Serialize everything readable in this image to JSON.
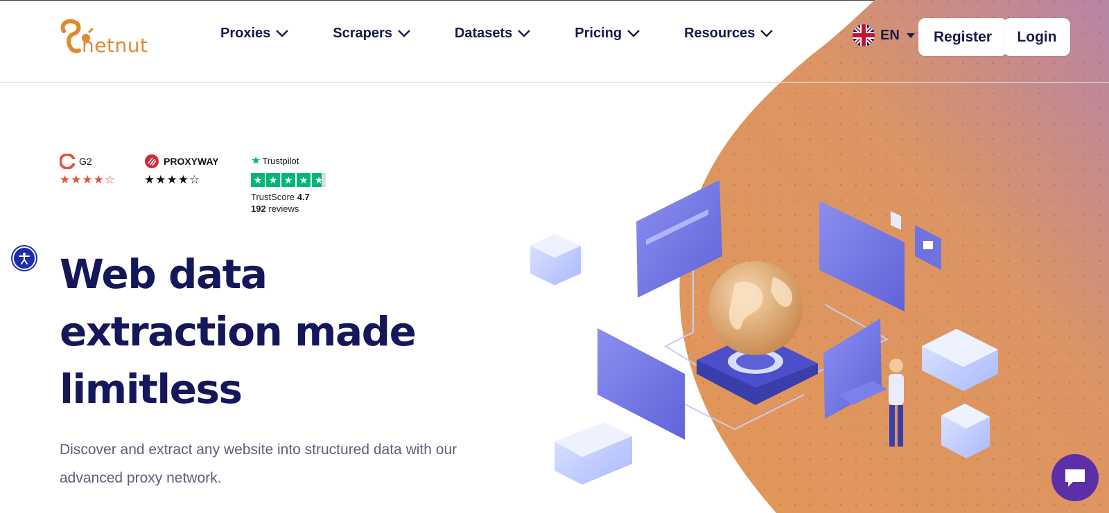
{
  "header": {
    "brand": "netnut",
    "nav": [
      {
        "label": "Proxies"
      },
      {
        "label": "Scrapers"
      },
      {
        "label": "Datasets"
      },
      {
        "label": "Pricing"
      },
      {
        "label": "Resources"
      }
    ],
    "language": "EN",
    "register_label": "Register",
    "login_label": "Login"
  },
  "ratings": {
    "g2": {
      "name": "G2",
      "stars": "★★★★☆",
      "value": 4.5
    },
    "proxyway": {
      "name": "PROXYWAY",
      "stars": "★★★★☆",
      "value": 4.5
    },
    "trustpilot": {
      "name": "Trustpilot",
      "value": 4.7,
      "score_label": "TrustScore",
      "score": "4.7",
      "reviews_count": "192",
      "reviews_label": "reviews"
    }
  },
  "hero": {
    "headline": [
      "Web data",
      "extraction made",
      "limitless"
    ],
    "subtext": "Discover and extract any website into structured data with our advanced proxy network."
  },
  "colors": {
    "brand_orange": "#e08a2e",
    "navy": "#14185a",
    "accent_purple": "#5b2fa8",
    "trustpilot_green": "#00b67a"
  }
}
